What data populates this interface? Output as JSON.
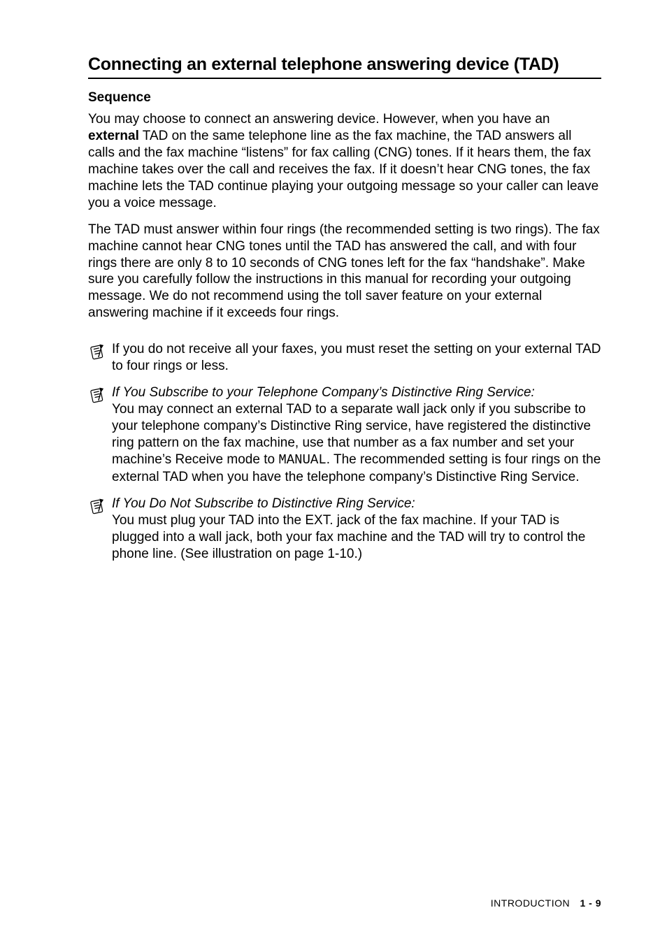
{
  "heading": "Connecting an external telephone answering device (TAD)",
  "subheading": "Sequence",
  "para1_a": "You may choose to connect an answering device. However, when you have an ",
  "para1_bold": "external",
  "para1_b": " TAD on the same telephone line as the fax machine, the TAD answers all calls and the fax machine “listens” for fax calling (CNG) tones. If it hears them, the fax machine takes over the call and receives the fax. If it doesn’t hear CNG tones, the fax machine lets the TAD continue playing your outgoing message so your caller can leave you a voice message.",
  "para2": "The TAD must answer within four rings (the recommended setting is two rings). The fax machine cannot hear CNG tones until the TAD has answered the call, and with four rings there are only 8 to 10 seconds of CNG tones left for the fax “handshake”. Make sure you carefully follow the instructions in this manual for recording your outgoing message. We do not recommend using the toll saver feature on your external answering machine if it exceeds four rings.",
  "note1": "If you do not receive all your faxes, you must reset the setting on your external TAD to four rings or less.",
  "note2_title": "If You Subscribe to your Telephone Company’s Distinctive Ring Service:",
  "note2_a": "You may connect an external TAD to a separate wall jack only if you subscribe to your telephone company’s Distinctive Ring service, have registered the distinctive ring pattern on the fax machine, use that number as a fax number and set your machine’s Receive mode to ",
  "note2_mono": "MANUAL",
  "note2_b": ". The recommended setting is four rings on the external TAD when you have the telephone company’s Distinctive Ring Service.",
  "note3_title": "If You Do Not Subscribe to Distinctive Ring Service:",
  "note3_body": "You must plug your TAD into the EXT. jack of the fax machine. If your TAD is plugged into a wall jack, both your fax machine and the TAD will try to control the phone line. (See illustration on page 1-10.)",
  "footer_label": "INTRODUCTION",
  "footer_page": "1 - 9"
}
